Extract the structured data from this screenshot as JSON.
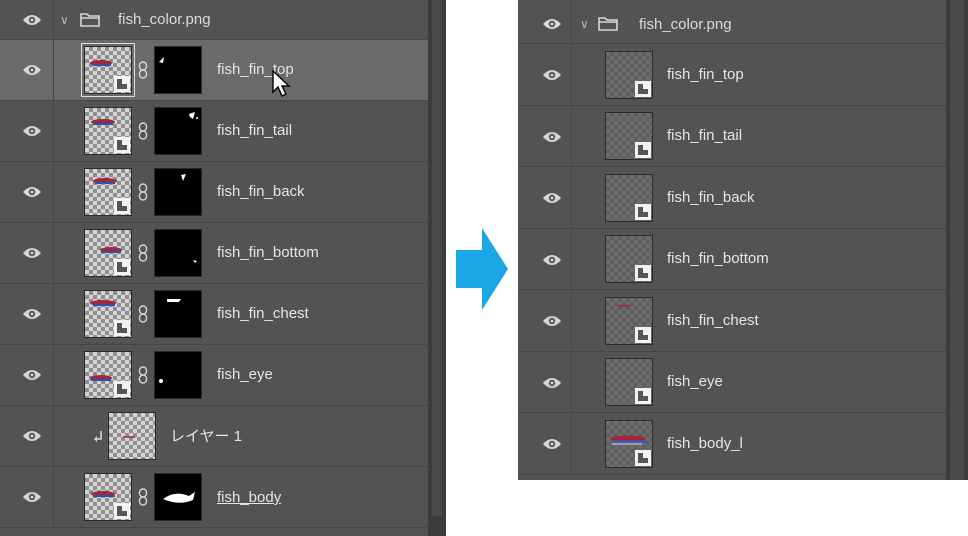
{
  "colors": {
    "panel_bg": "#535353",
    "selected_row": "#6a6a6a",
    "arrow": "#1aa7e8",
    "text": "#e6e6e6"
  },
  "before": {
    "group": {
      "name": "fish_color.png",
      "expanded": true,
      "visible": true
    },
    "layers": [
      {
        "name": "fish_fin_top",
        "type": "smart-object-with-mask",
        "selected": true,
        "visible": true
      },
      {
        "name": "fish_fin_tail",
        "type": "smart-object-with-mask",
        "selected": false,
        "visible": true
      },
      {
        "name": "fish_fin_back",
        "type": "smart-object-with-mask",
        "selected": false,
        "visible": true
      },
      {
        "name": "fish_fin_bottom",
        "type": "smart-object-with-mask",
        "selected": false,
        "visible": true
      },
      {
        "name": "fish_fin_chest",
        "type": "smart-object-with-mask",
        "selected": false,
        "visible": true
      },
      {
        "name": "fish_eye",
        "type": "smart-object-with-mask",
        "selected": false,
        "visible": true
      },
      {
        "name": "レイヤー 1",
        "type": "clipping-layer",
        "selected": false,
        "visible": true
      },
      {
        "name": "fish_body",
        "type": "smart-object-with-mask",
        "selected": false,
        "visible": true
      }
    ]
  },
  "after": {
    "group": {
      "name": "fish_color.png",
      "expanded": true,
      "visible": true
    },
    "layers": [
      {
        "name": "fish_fin_top",
        "type": "smart-object",
        "visible": true
      },
      {
        "name": "fish_fin_tail",
        "type": "smart-object",
        "visible": true
      },
      {
        "name": "fish_fin_back",
        "type": "smart-object",
        "visible": true
      },
      {
        "name": "fish_fin_bottom",
        "type": "smart-object",
        "visible": true
      },
      {
        "name": "fish_fin_chest",
        "type": "smart-object",
        "visible": true
      },
      {
        "name": "fish_eye",
        "type": "smart-object",
        "visible": true
      },
      {
        "name": "fish_body_l",
        "type": "smart-object",
        "visible": true
      }
    ]
  },
  "icons": {
    "visibility": "eye-icon",
    "group": "folder-icon",
    "expand": "chevron-down-icon",
    "mask_link": "chain-link-icon",
    "smart_object": "smart-object-badge-icon",
    "clipping": "clipping-arrow-icon",
    "pointer": "mouse-cursor-icon",
    "transition": "right-arrow-icon"
  }
}
